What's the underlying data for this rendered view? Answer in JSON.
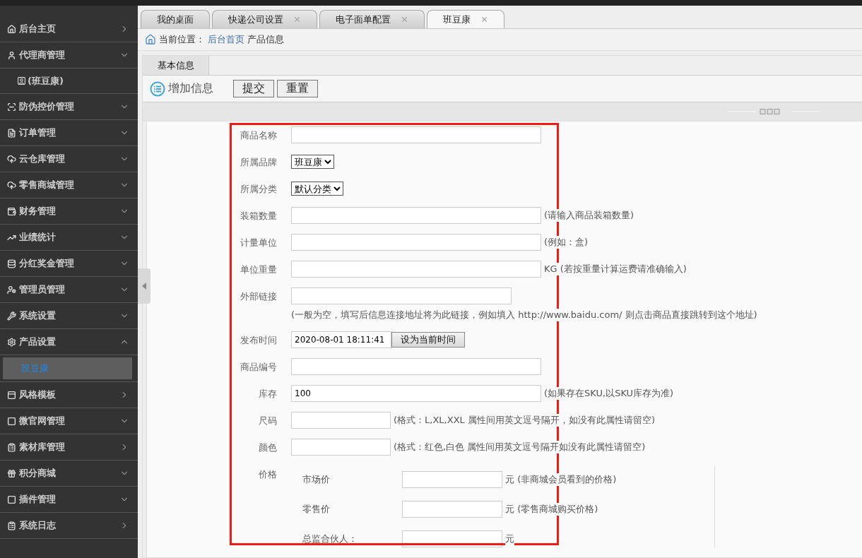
{
  "sidebar": {
    "items": [
      {
        "label": "后台主页",
        "kind": "link"
      },
      {
        "label": "代理商管理",
        "kind": "group",
        "expanded": false,
        "children": [
          {
            "label": "(班豆康)",
            "selected": false
          }
        ]
      },
      {
        "label": "防伪控价管理",
        "kind": "group",
        "expanded": false
      },
      {
        "label": "订单管理",
        "kind": "group",
        "expanded": false
      },
      {
        "label": "云仓库管理",
        "kind": "group",
        "expanded": false
      },
      {
        "label": "零售商城管理",
        "kind": "group",
        "expanded": false
      },
      {
        "label": "财务管理",
        "kind": "group",
        "expanded": false
      },
      {
        "label": "业绩统计",
        "kind": "group",
        "expanded": false
      },
      {
        "label": "分红奖金管理",
        "kind": "group",
        "expanded": false
      },
      {
        "label": "管理员管理",
        "kind": "group",
        "expanded": false
      },
      {
        "label": "系统设置",
        "kind": "group",
        "expanded": false
      },
      {
        "label": "产品设置",
        "kind": "group",
        "expanded": true,
        "children": [
          {
            "label": "班豆康",
            "selected": true
          }
        ]
      },
      {
        "label": "风格模板",
        "kind": "link"
      },
      {
        "label": "微官网管理",
        "kind": "group",
        "expanded": false
      },
      {
        "label": "素材库管理",
        "kind": "link"
      },
      {
        "label": "积分商城",
        "kind": "group",
        "expanded": false
      },
      {
        "label": "插件管理",
        "kind": "group",
        "expanded": false
      },
      {
        "label": "系统日志",
        "kind": "link"
      }
    ]
  },
  "tabs": [
    {
      "label": "我的桌面",
      "closable": false,
      "selected": false
    },
    {
      "label": "快递公司设置",
      "closable": true,
      "selected": false
    },
    {
      "label": "电子面单配置",
      "closable": true,
      "selected": false
    },
    {
      "label": "班豆康",
      "closable": true,
      "selected": true
    }
  ],
  "breadcrumb": {
    "label": "当前位置：",
    "link": "后台首页",
    "current": "产品信息"
  },
  "panel_tabs": [
    {
      "label": "基本信息",
      "selected": true
    }
  ],
  "toolbar": {
    "title": "增加信息",
    "buttons": [
      "提交",
      "重置"
    ]
  },
  "form": {
    "rows": [
      {
        "kind": "long",
        "label": "商品名称"
      },
      {
        "kind": "select",
        "label": "所属品牌",
        "value": "班豆康"
      },
      {
        "kind": "select",
        "label": "所属分类",
        "value": "默认分类"
      },
      {
        "kind": "long",
        "label": "装箱数量",
        "note": "(请输入商品装箱数量)"
      },
      {
        "kind": "long",
        "label": "计量单位",
        "note": "(例如：盒)"
      },
      {
        "kind": "long",
        "label": "单位重量",
        "note": "KG (若按重量计算运费请准确输入)"
      },
      {
        "kind": "medium",
        "label": "外部链接",
        "note": "(一般为空，填写后信息连接地址将为此链接，例如填入 http://www.baidu.com/ 则点击商品直接跳转到这个地址)"
      },
      {
        "kind": "datetime",
        "label": "发布时间",
        "value": "2020-08-01 18:11:41",
        "button": "设为当前时间"
      },
      {
        "kind": "long",
        "label": "商品编号"
      },
      {
        "kind": "long",
        "label": "库存",
        "value": "100",
        "note": "(如果存在SKU,以SKU库存为准)"
      },
      {
        "kind": "short",
        "label": "尺码",
        "note": "(格式：L,XL,XXL 属性间用英文逗号隔开，如没有此属性请留空)"
      },
      {
        "kind": "short",
        "label": "颜色",
        "note": "(格式：红色,白色 属性间用英文逗号隔开如没有此属性请留空)"
      },
      {
        "kind": "price",
        "label": "价格",
        "items": [
          {
            "label": "市场价",
            "note": "元 (非商城会员看到的价格)"
          },
          {
            "label": "零售价",
            "note": "元 (零售商城购买价格)"
          },
          {
            "label": "总监合伙人：",
            "note": "元"
          }
        ]
      }
    ]
  }
}
